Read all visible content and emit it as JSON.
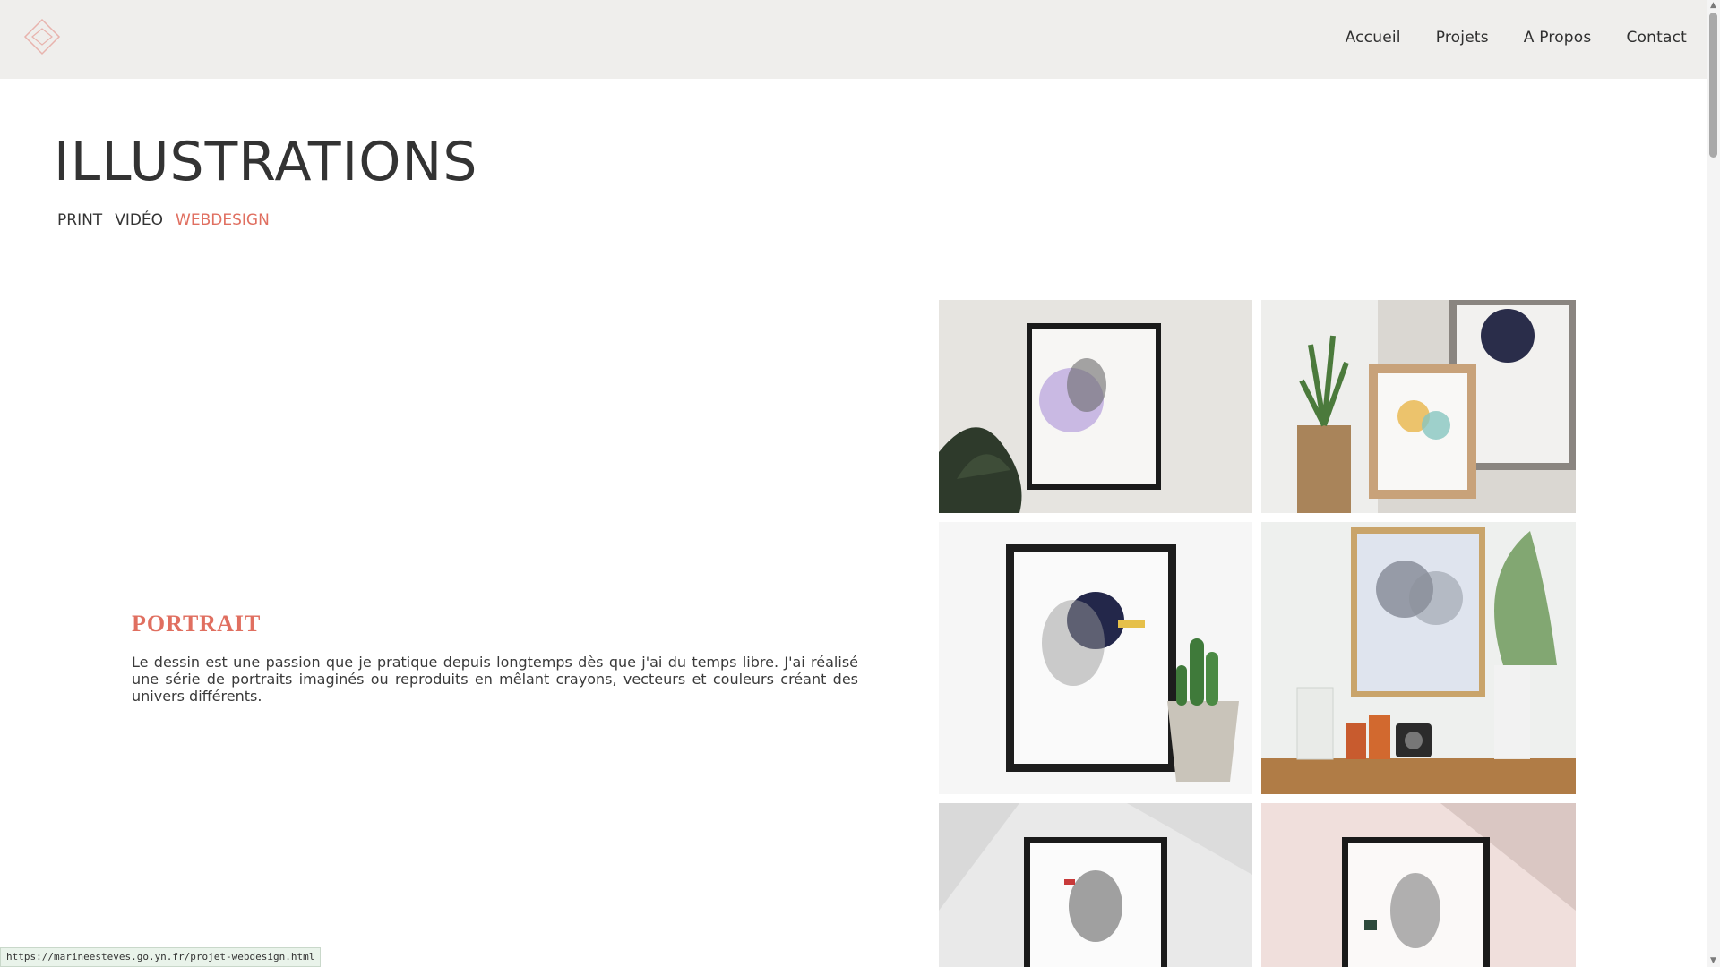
{
  "nav": {
    "items": [
      {
        "label": "Accueil"
      },
      {
        "label": "Projets"
      },
      {
        "label": "A Propos"
      },
      {
        "label": "Contact"
      }
    ]
  },
  "page": {
    "title": "ILLUSTRATIONS",
    "filters": [
      {
        "label": "PRINT"
      },
      {
        "label": "VIDÉO"
      },
      {
        "label": "WEBDESIGN",
        "active": true
      }
    ]
  },
  "project": {
    "title": "PORTRAIT",
    "description": "Le dessin est une passion que je pratique depuis longtemps dès que j'ai du temps libre. J'ai réalisé une série de portraits imaginés ou reproduits en mêlant crayons, vecteurs et couleurs créant des univers différents."
  },
  "gallery": {
    "images": [
      {
        "icon": "framed-portrait-purple-image"
      },
      {
        "icon": "framed-portrait-wood-frame-image"
      },
      {
        "icon": "framed-portrait-cactus-image"
      },
      {
        "icon": "framed-portrait-plants-shelf-image"
      },
      {
        "icon": "framed-portrait-marble-image"
      },
      {
        "icon": "framed-portrait-pink-wall-image"
      }
    ]
  },
  "status": {
    "url": "https://marineesteves.go.yn.fr/projet-webdesign.html"
  },
  "colors": {
    "accent": "#e06f60",
    "header_bg": "#efeeec",
    "text": "#333333"
  }
}
